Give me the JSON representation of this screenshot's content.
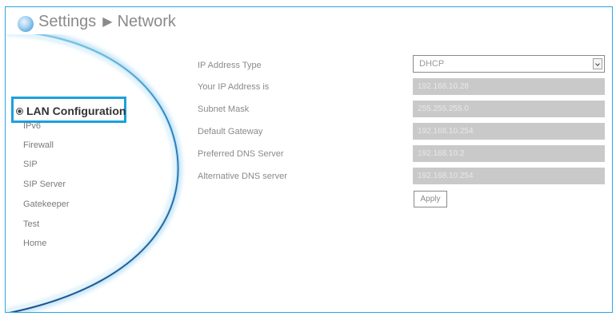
{
  "header": {
    "breadcrumb_root": "Settings",
    "breadcrumb_separator": "▶",
    "breadcrumb_current": "Network",
    "logo_icon": "globe-icon"
  },
  "sidebar": {
    "items": [
      {
        "label": "LAN Configuration",
        "active": true
      },
      {
        "label": "IPv6"
      },
      {
        "label": "Firewall"
      },
      {
        "label": "SIP"
      },
      {
        "label": "SIP Server"
      },
      {
        "label": "Gatekeeper"
      },
      {
        "label": "Test"
      },
      {
        "label": "Home"
      }
    ]
  },
  "form": {
    "ip_type": {
      "label": "IP Address Type",
      "value": "DHCP"
    },
    "ip_address": {
      "label": "Your IP Address is",
      "value": "192.168.10.28"
    },
    "subnet_mask": {
      "label": "Subnet Mask",
      "value": "255.255.255.0"
    },
    "gateway": {
      "label": "Default Gateway",
      "value": "192.168.10.254"
    },
    "dns_preferred": {
      "label": "Preferred DNS Server",
      "value": "192.168.10.2"
    },
    "dns_alternative": {
      "label": "Alternative DNS server",
      "value": "192.168.10.254"
    },
    "apply_label": "Apply"
  },
  "colors": {
    "accent": "#1aa1dc",
    "disabled_field": "#c9c9c9"
  }
}
